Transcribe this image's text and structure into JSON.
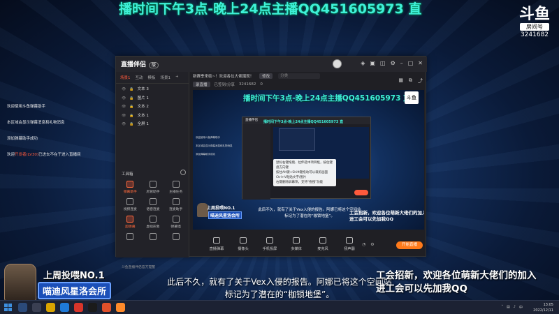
{
  "overlay": {
    "top_banner": "播时间下午3点-晚上24点主播QQ451605973 直",
    "room_logo_glyph": "斗鱼",
    "room_logo_tag": "房间号",
    "room_number": "3241682",
    "side_messages": [
      {
        "text": "欢迎使用斗鱼弹幕助手",
        "highlight": ""
      },
      {
        "text": "本区域会显示弹幕消息和礼物消息",
        "highlight": ""
      },
      {
        "text": "添加弹幕助手成功",
        "highlight": ""
      },
      {
        "text": "欢迎",
        "highlight": "开发者(LV30)",
        "suffix": "已进去不在于进入直播间"
      }
    ],
    "badge_line1": "上周投喂NO.1",
    "badge_line2": "喵迪风星洛会所",
    "subtitle_line1": "此后不久，就有了关于Vex入侵的报告。阿娜已将这个空间站",
    "subtitle_line2": "标记为了潜在的“枷锁地堡”。",
    "recruit_line1": "工会招新，欢迎各位萌新大佬们的加入",
    "recruit_line2": "进工会可以先加我QQ"
  },
  "app": {
    "brand": "直播伴侣",
    "version": "版",
    "titlebar_icons": [
      "shirt-icon",
      "gift-icon",
      "chat-icon",
      "settings-icon",
      "minimize-icon",
      "maximize-icon",
      "close-icon"
    ],
    "tabs": [
      "场景1",
      "互动",
      "模板",
      "场景1",
      "+"
    ],
    "scenes": [
      {
        "type": "文本",
        "label": "文本 3"
      },
      {
        "type": "图片",
        "label": "图片 1"
      },
      {
        "type": "文本",
        "label": "文本 2"
      },
      {
        "type": "文本",
        "label": "文本 1"
      },
      {
        "type": "全屏",
        "label": "全屏 1"
      }
    ],
    "tools_title": "工具箱",
    "tools": [
      {
        "label": "弹幕助手",
        "accent": true
      },
      {
        "label": "房管助手",
        "accent": false
      },
      {
        "label": "主播任务",
        "accent": false
      },
      {
        "label": "视频连麦",
        "accent": false
      },
      {
        "label": "语音连麦",
        "accent": false
      },
      {
        "label": "连麦助手",
        "accent": false
      },
      {
        "label": "超弹幕",
        "accent": true
      },
      {
        "label": "虚拟形象",
        "accent": false
      },
      {
        "label": "弹幕墙",
        "accent": false
      },
      {
        "label": "",
        "accent": false
      },
      {
        "label": "",
        "accent": false
      },
      {
        "label": "",
        "accent": false
      }
    ],
    "footer": "斗鱼直播伴侣官方提醒",
    "info_row1_title": "新赛季来临~！欢迎各位大佬围观！",
    "info_row1_btn": "修改",
    "info_row1_field": "分类",
    "info_row2_btn": "录直播",
    "info_row2_meta": "已签到/分享",
    "info_row2_room": "3241682",
    "info_row2_count": "0",
    "controls": [
      {
        "label": "直播弹幕"
      },
      {
        "label": "摄像头"
      },
      {
        "label": "手机投屏"
      },
      {
        "label": "多媒体"
      },
      {
        "label": "麦克风"
      },
      {
        "label": "扬声器"
      }
    ],
    "go_live": "开始直播",
    "preview_tips": [
      "鼠标右键拖拽、拉伸选中项目框，按住键盘方向键",
      "按住Alt键+Shift键拖动可以裁剪画面",
      "Ctrl+V粘贴文字/图片",
      "右键删除屏幕项，支持\"拖拽\"功能"
    ],
    "preview_logo": "斗鱼"
  },
  "taskbar": {
    "time": "13:05",
    "date": "2022/12/11",
    "tray_ime": "中"
  }
}
